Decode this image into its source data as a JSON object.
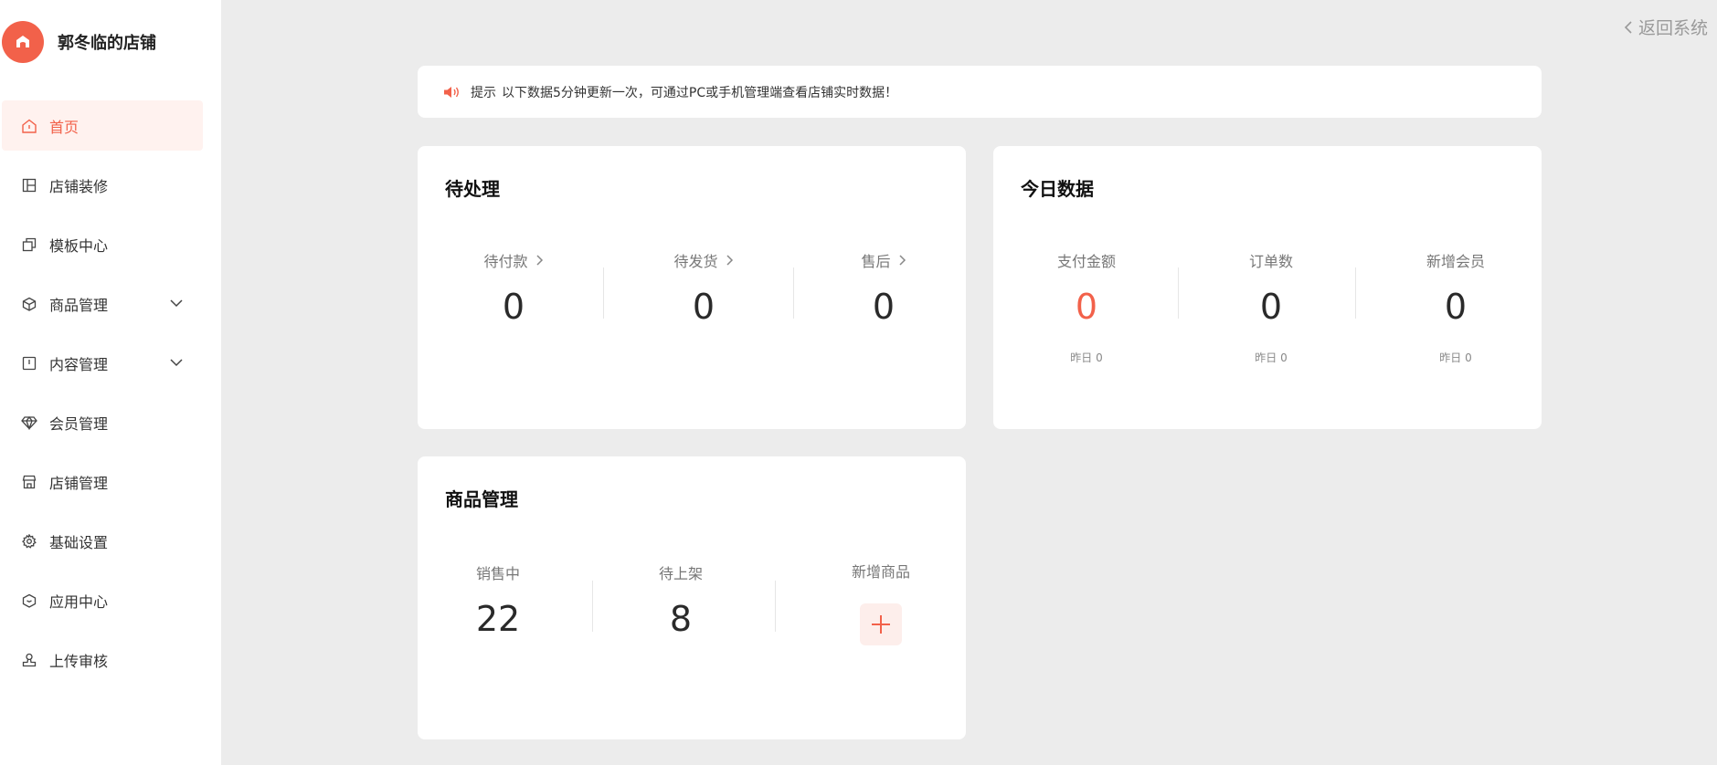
{
  "app": {
    "shop_name": "郭冬临的店铺",
    "back_label": "返回系统",
    "accent_color": "#f2614a"
  },
  "sidebar": {
    "items": [
      {
        "label": "首页",
        "icon": "home-icon",
        "active": true
      },
      {
        "label": "店铺装修",
        "icon": "layout-icon"
      },
      {
        "label": "模板中心",
        "icon": "copy-icon"
      },
      {
        "label": "商品管理",
        "icon": "cube-icon",
        "expandable": true
      },
      {
        "label": "内容管理",
        "icon": "book-icon",
        "expandable": true
      },
      {
        "label": "会员管理",
        "icon": "diamond-icon"
      },
      {
        "label": "店铺管理",
        "icon": "store-icon"
      },
      {
        "label": "基础设置",
        "icon": "gear-icon"
      },
      {
        "label": "应用中心",
        "icon": "box-icon"
      },
      {
        "label": "上传审核",
        "icon": "stamp-icon"
      }
    ]
  },
  "tip": {
    "label": "提示",
    "text": "以下数据5分钟更新一次，可通过PC或手机管理端查看店铺实时数据！"
  },
  "pending": {
    "title": "待处理",
    "items": [
      {
        "label": "待付款",
        "value": "0"
      },
      {
        "label": "待发货",
        "value": "0"
      },
      {
        "label": "售后",
        "value": "0"
      }
    ]
  },
  "today": {
    "title": "今日数据",
    "items": [
      {
        "label": "支付金额",
        "value": "0",
        "sub": "昨日 0"
      },
      {
        "label": "订单数",
        "value": "0",
        "sub": "昨日 0"
      },
      {
        "label": "新增会员",
        "value": "0",
        "sub": "昨日 0"
      }
    ]
  },
  "products": {
    "title": "商品管理",
    "items": [
      {
        "label": "销售中",
        "value": "22"
      },
      {
        "label": "待上架",
        "value": "8"
      }
    ],
    "add_label": "新增商品"
  }
}
